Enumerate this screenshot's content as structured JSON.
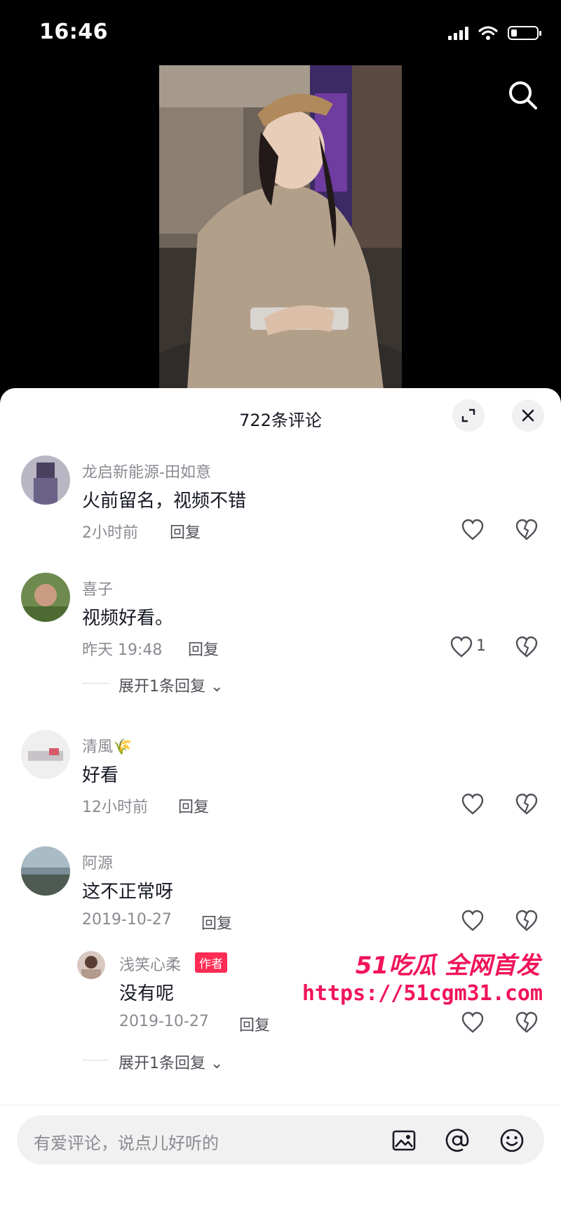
{
  "status_bar": {
    "time": "16:46"
  },
  "sheet": {
    "title": "722条评论"
  },
  "comments": [
    {
      "username": "龙启新能源-田如意",
      "text": "火前留名，视频不错",
      "time": "2小时前",
      "reply": "回复",
      "likes": ""
    },
    {
      "username": "喜子",
      "text": "视频好看。",
      "time": "昨天 19:48",
      "reply": "回复",
      "likes": "1",
      "expand": "展开1条回复"
    },
    {
      "username": "清風🌾",
      "text": "好看",
      "time": "12小时前",
      "reply": "回复",
      "likes": ""
    },
    {
      "username": "阿源",
      "text": "这不正常呀",
      "time": "2019-10-27",
      "reply": "回复",
      "likes": ""
    }
  ],
  "sub_reply": {
    "username": "浅笑心柔",
    "badge": "作者",
    "text": "没有呢",
    "time": "2019-10-27",
    "reply": "回复",
    "expand": "展开1条回复"
  },
  "input": {
    "placeholder": "有爱评论，说点儿好听的"
  },
  "watermark": {
    "line1": "51吃瓜 全网首发",
    "line2": "https://51cgm31.com"
  },
  "colors": {
    "accent": "#fe2c55",
    "watermark": "#f0145a",
    "sheet_bg": "#ffffff"
  }
}
